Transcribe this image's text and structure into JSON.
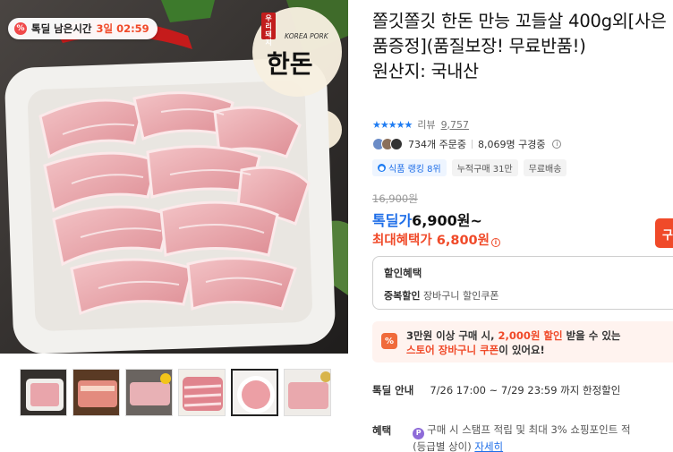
{
  "deal_timer": {
    "label": "톡딜 남은시간",
    "time": "3일 02:59"
  },
  "logo": {
    "korea_pork": "KOREA PORK",
    "brand": "한돈",
    "seal": "우리돼지"
  },
  "product": {
    "title": "쫄깃쫄깃 한돈 만능 꼬들살 400g외[사은품증정](품질보장! 무료반품!)",
    "origin": "원산지: 국내산"
  },
  "rating": {
    "stars": "★★★★★",
    "review_label": "리뷰",
    "review_count": "9,757"
  },
  "buyers": {
    "ordering": "734개 주문중",
    "subscribers": "8,069명 구경중"
  },
  "badges": [
    {
      "label": "식품 랭킹 8위",
      "style": "blue"
    },
    {
      "label": "누적구매 31만",
      "style": "gray"
    },
    {
      "label": "무료배송",
      "style": "gray"
    }
  ],
  "price": {
    "original": "16,900원",
    "deal_label": "톡딜가",
    "deal_value": "6,900원~",
    "max_label": "최대혜택가",
    "max_value": "6,800원"
  },
  "buy_button": {
    "label": "구"
  },
  "benefit_box": {
    "heading": "할인혜택",
    "row_label": "중복할인",
    "row_value": "장바구니 할인쿠폰"
  },
  "coupon": {
    "line1_pre": "3만원 이상 구매 시, ",
    "line1_hl": "2,000원 할인",
    "line1_post": " 받을 수 있는",
    "line2_hl": "스토어 장바구니 쿠폰",
    "line2_post": "이 있어요!"
  },
  "deal_info": {
    "label": "톡딜 안내",
    "value": "7/26 17:00 ~ 7/29 23:59 까지 한정할인"
  },
  "benefit": {
    "label": "혜택",
    "line1": "구매 시 스탬프 적립 및 최대 3% 쇼핑포인트 적",
    "line2": "(등급별 상이)",
    "link": "자세히"
  },
  "thumbnails": [
    "thumb-1",
    "thumb-2",
    "thumb-3",
    "thumb-4",
    "thumb-5",
    "thumb-6"
  ],
  "colors": {
    "accent_blue": "#1e6ee8",
    "accent_red": "#f04a29",
    "star_blue": "#1e7cf2"
  }
}
